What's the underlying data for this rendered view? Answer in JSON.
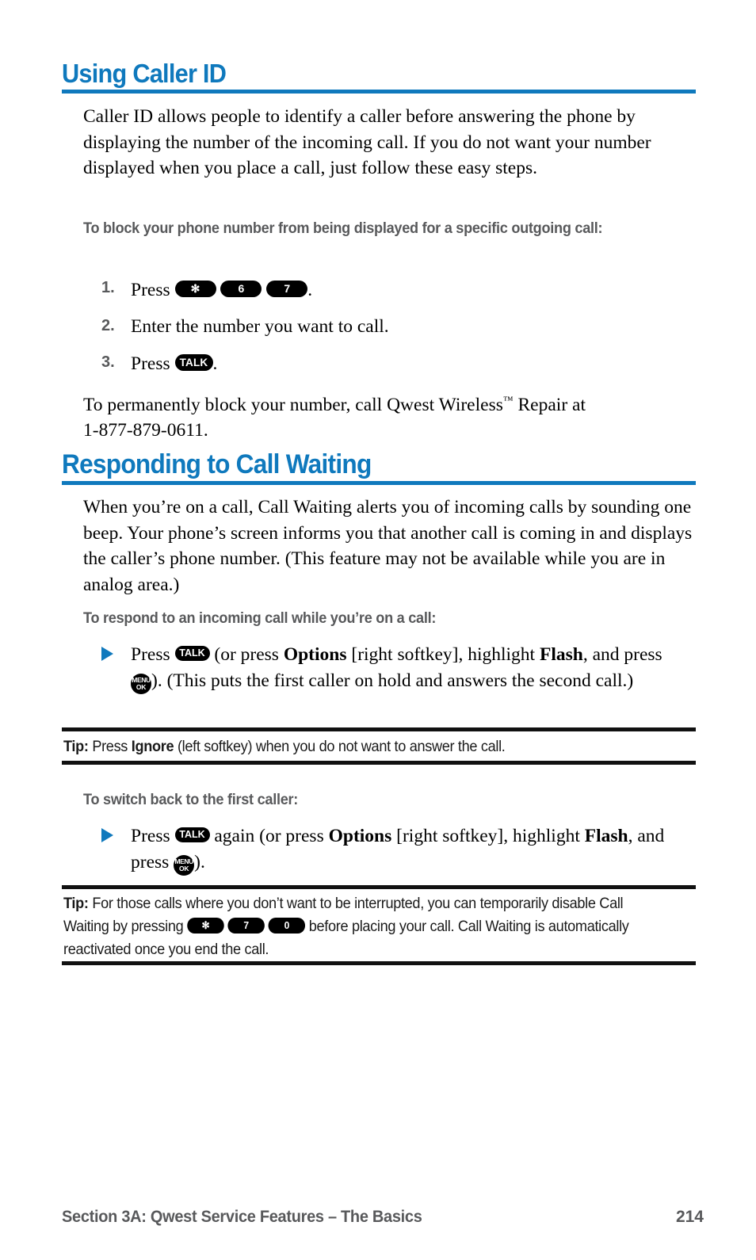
{
  "page": {
    "number": "214",
    "footer_section": "Section 3A: Qwest Service Features – The Basics",
    "accent_color": "#0f79bd",
    "subhead_color": "#58595b",
    "rule_color": "#111111"
  },
  "section1": {
    "heading": "Using Caller ID",
    "intro": "Caller ID allows people to identify a caller before answering the phone by displaying the number of the incoming call. If you do not want your number displayed when you place a call, just follow these easy steps.",
    "subhead": "To block your phone number from being displayed for a specific outgoing call:",
    "steps": [
      {
        "number": "1.",
        "lead": "Press",
        "keys": [
          "✻",
          "6",
          "7"
        ],
        "trail": "."
      },
      {
        "number": "2.",
        "text": "Enter the number you want to call."
      },
      {
        "number": "3.",
        "lead": "Press",
        "keys": [
          "TALK"
        ],
        "trail": "."
      }
    ],
    "closing_line1_a": "To permanently block your number, call Qwest Wireless",
    "closing_tm": "™",
    "closing_line1_b": " Repair at",
    "closing_line2": "1-877-879-0611."
  },
  "section2": {
    "heading": "Responding to Call Waiting",
    "intro": "When you’re on a call, Call Waiting alerts you of incoming calls by sounding one beep. Your phone’s screen informs you that another call is coming in and displays the caller’s phone number. (This feature may not be available while you are in analog area.)",
    "subhead1": "To respond to an incoming call while you’re on a call:",
    "bullet1": {
      "t1": "Press ",
      "key_talk": "TALK",
      "t2": " (or press ",
      "bold1": "Options",
      "t3": " [right softkey], highlight ",
      "bold2": "Flash",
      "t4": ", and press ",
      "key_menu_l1": "MENU",
      "key_menu_l2": "OK",
      "t5": "). (This puts the first caller on hold and answers the second call.)"
    },
    "tip1": {
      "label": "Tip:",
      "t1": " Press ",
      "bold1": "Ignore",
      "t2": " (left softkey) when you do not want to answer the call."
    },
    "subhead2": "To switch back to the first caller:",
    "bullet2": {
      "t1": "Press ",
      "key_talk": "TALK",
      "t2": " again (or press ",
      "bold1": "Options",
      "t3": " [right softkey], highlight ",
      "bold2": "Flash",
      "t4": ", and press ",
      "key_menu_l1": "MENU",
      "key_menu_l2": "OK",
      "t5": ")."
    },
    "tip2": {
      "label": "Tip:",
      "t1": " For those calls where you don’t want to be interrupted, you can temporarily disable Call Waiting by pressing ",
      "keys": [
        "✻",
        "7",
        "0"
      ],
      "t2": " before placing your call. Call Waiting is automatically reactivated once you end the call."
    }
  }
}
